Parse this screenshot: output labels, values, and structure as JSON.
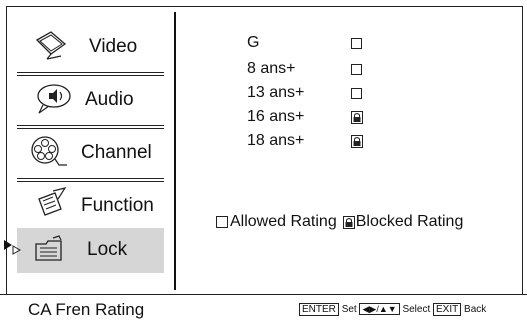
{
  "menu": {
    "items": [
      {
        "label": "Video",
        "icon": "video-icon"
      },
      {
        "label": "Audio",
        "icon": "audio-icon"
      },
      {
        "label": "Channel",
        "icon": "channel-icon"
      },
      {
        "label": "Function",
        "icon": "function-icon"
      },
      {
        "label": "Lock",
        "icon": "lock-folder-icon",
        "active": true
      }
    ]
  },
  "ratings": [
    {
      "label": "G",
      "state": "allowed"
    },
    {
      "label": "8 ans+",
      "state": "allowed"
    },
    {
      "label": "13 ans+",
      "state": "allowed"
    },
    {
      "label": "16 ans+",
      "state": "blocked"
    },
    {
      "label": "18 ans+",
      "state": "blocked"
    }
  ],
  "legend": {
    "allowed": "Allowed Rating",
    "blocked": "Blocked Rating"
  },
  "status": {
    "title": "CA Fren Rating",
    "enter_key": "ENTER",
    "enter_action": "Set",
    "arrows_key": "◀▶/▲▼",
    "arrows_action": "Select",
    "exit_key": "EXIT",
    "exit_action": "Back"
  }
}
